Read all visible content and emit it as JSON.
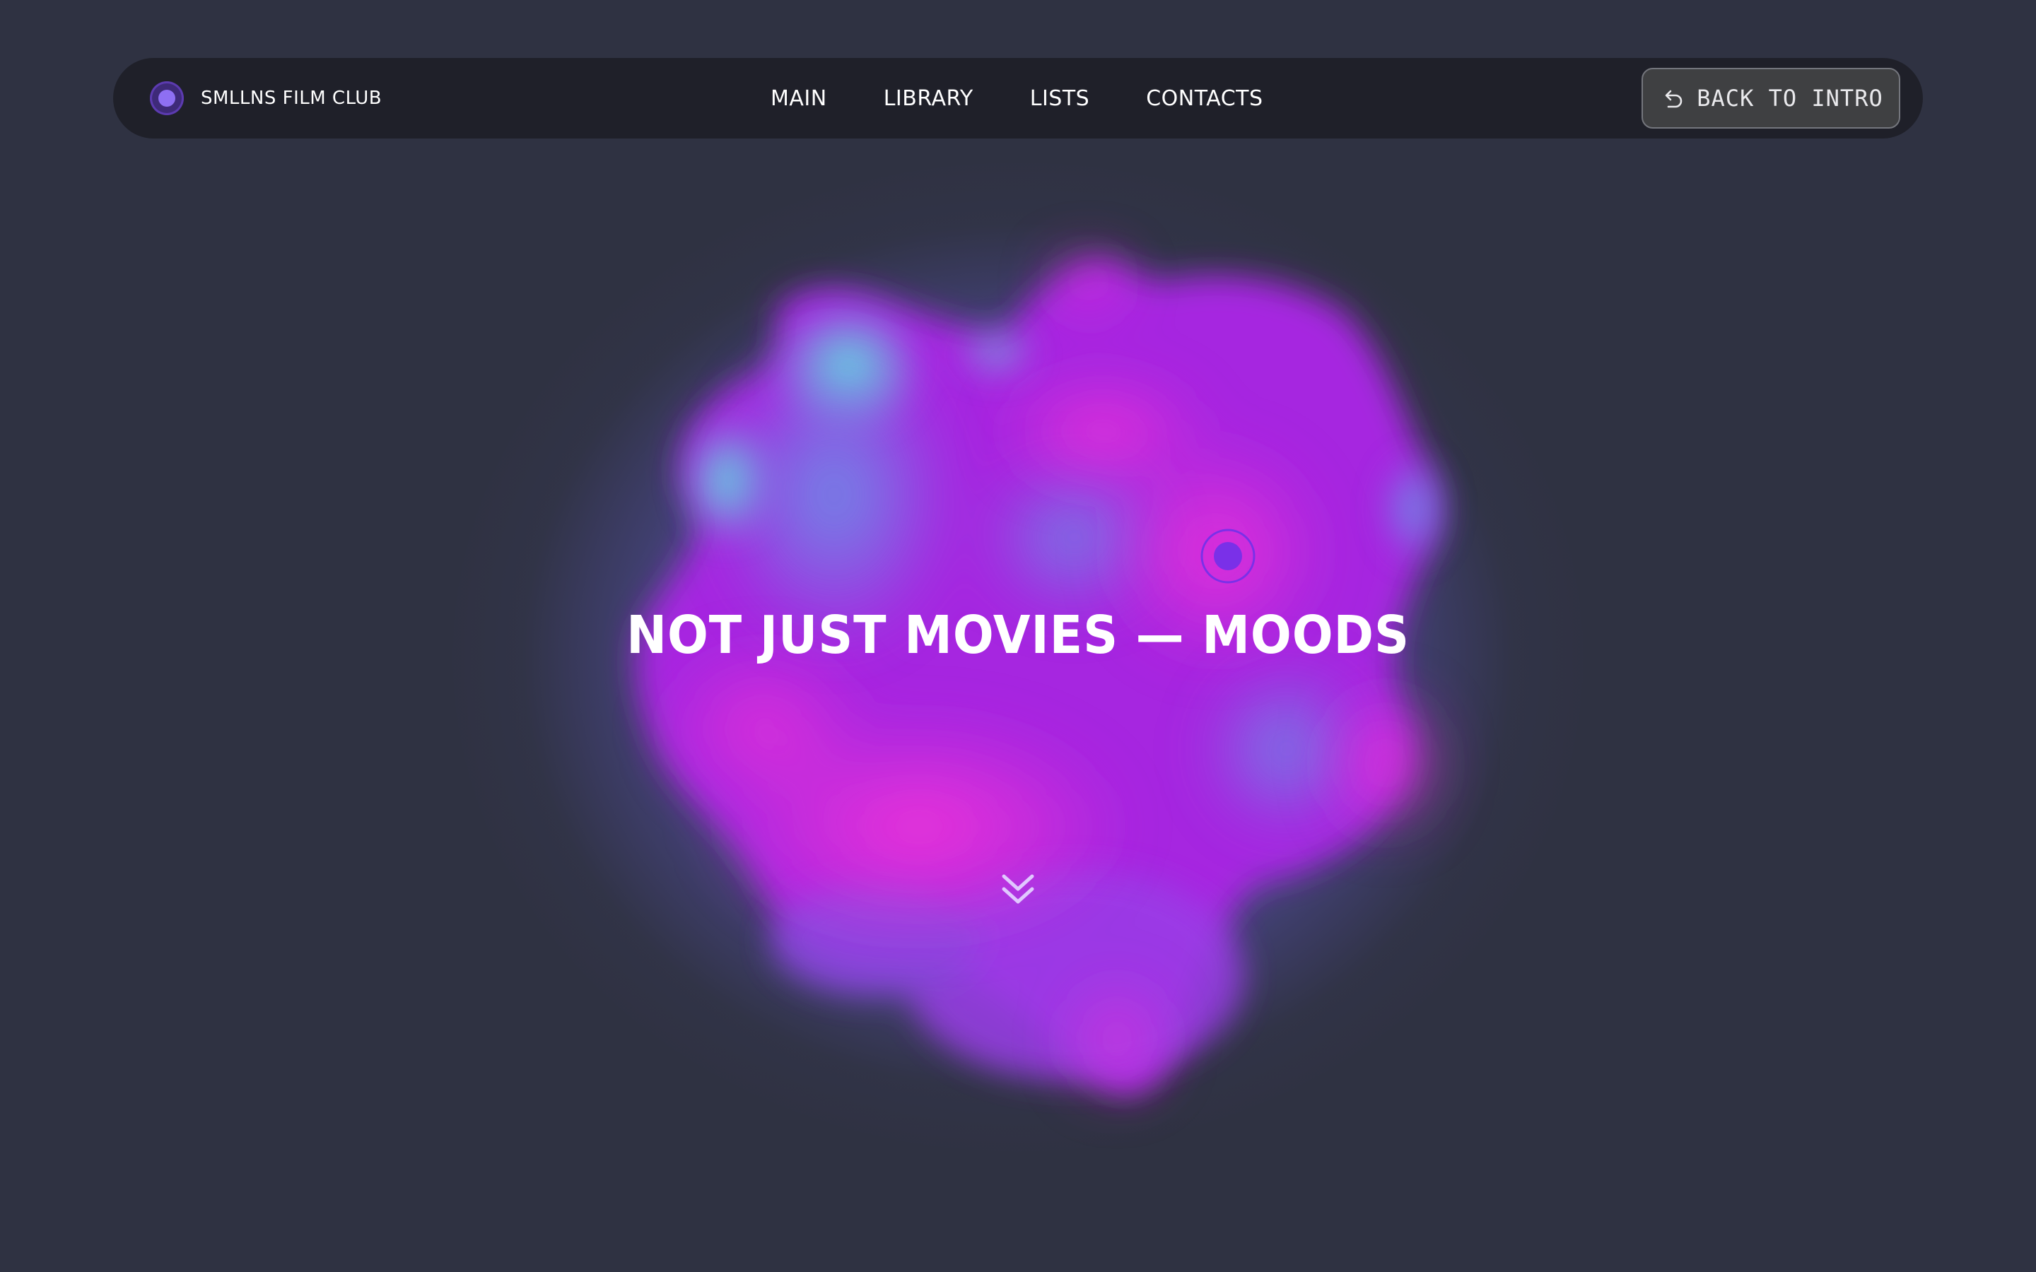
{
  "brand": {
    "name": "SMLLNS FILM CLUB",
    "icon": "brand-dot-icon"
  },
  "nav": {
    "links": [
      {
        "label": "MAIN"
      },
      {
        "label": "LIBRARY"
      },
      {
        "label": "LISTS"
      },
      {
        "label": "CONTACTS"
      }
    ]
  },
  "header": {
    "back_button": {
      "label": "BACK TO INTRO",
      "icon": "undo-arrow-icon"
    }
  },
  "hero": {
    "title": "NOT JUST MOVIES — MOODS",
    "target_icon": "target-icon",
    "scroll_icon": "chevrons-down-icon"
  },
  "colors": {
    "background": "#2f3242",
    "navbar": "#1f2029",
    "accent_purple": "#7c3aed",
    "blob_magenta": "#e030d8",
    "blob_violet": "#a22ae0",
    "blob_cyan": "#5fe0e0",
    "button_bg": "#3f4042"
  }
}
